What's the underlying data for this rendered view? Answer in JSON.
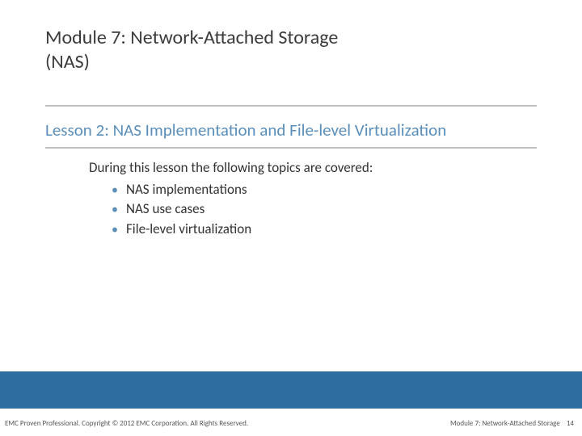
{
  "header": {
    "module_title": "Module 7: Network-Attached Storage (NAS)"
  },
  "lesson": {
    "title": "Lesson 2: NAS Implementation and File-level Virtualization",
    "intro": "During this lesson the following topics are covered:",
    "bullets": [
      "NAS implementations",
      "NAS use cases",
      "File-level virtualization"
    ]
  },
  "footer": {
    "brand": "EMC Proven Professional.",
    "copyright": " Copyright © 2012 EMC Corporation. All Rights Reserved.",
    "module_label": "Module 7: Network-Attached Storage",
    "page_number": "14"
  }
}
